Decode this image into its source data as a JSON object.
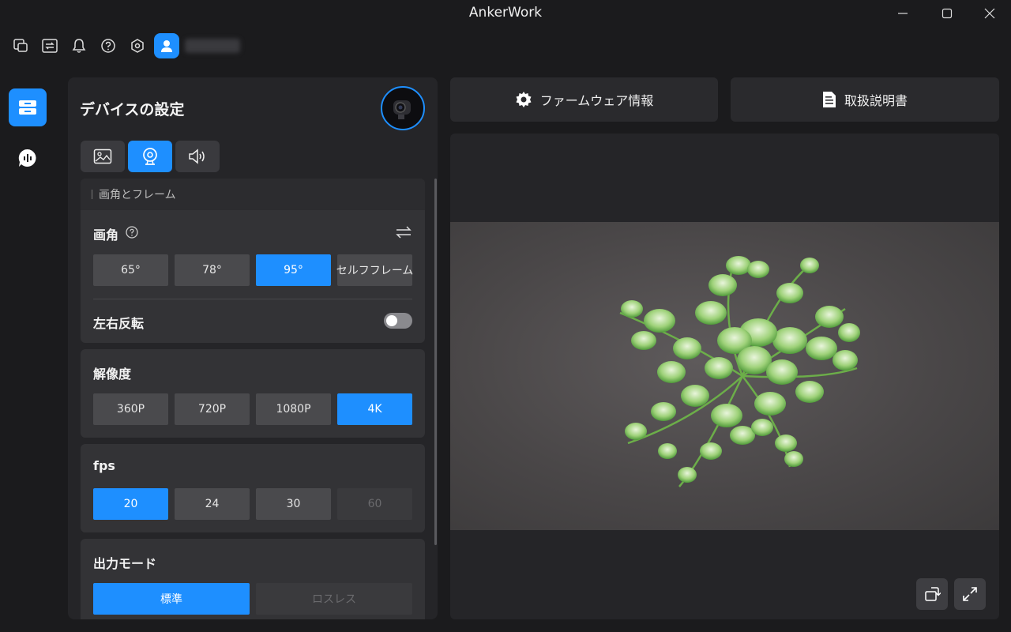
{
  "app": {
    "title": "AnkerWork"
  },
  "toolbar": {
    "icons": [
      "window-switch-icon",
      "swap-icon",
      "bell-icon",
      "help-icon",
      "hexagon-settings-icon"
    ]
  },
  "settings": {
    "title": "デバイスの設定",
    "tabs": [
      {
        "icon": "image-icon",
        "active": false
      },
      {
        "icon": "webcam-icon",
        "active": true
      },
      {
        "icon": "speaker-icon",
        "active": false
      }
    ],
    "fov_section": {
      "header": "画角とフレーム",
      "fov_label": "画角",
      "options": [
        {
          "label": "65°",
          "state": "normal"
        },
        {
          "label": "78°",
          "state": "normal"
        },
        {
          "label": "95°",
          "state": "active"
        },
        {
          "label": "セルフフレーム",
          "state": "normal"
        }
      ],
      "mirror_label": "左右反転",
      "mirror_on": false
    },
    "resolution": {
      "label": "解像度",
      "options": [
        {
          "label": "360P",
          "state": "normal"
        },
        {
          "label": "720P",
          "state": "normal"
        },
        {
          "label": "1080P",
          "state": "normal"
        },
        {
          "label": "4K",
          "state": "active"
        }
      ]
    },
    "fps": {
      "label": "fps",
      "options": [
        {
          "label": "20",
          "state": "active"
        },
        {
          "label": "24",
          "state": "normal"
        },
        {
          "label": "30",
          "state": "normal"
        },
        {
          "label": "60",
          "state": "disabled"
        }
      ]
    },
    "output_mode": {
      "label": "出力モード",
      "options": [
        {
          "label": "標準",
          "state": "active"
        },
        {
          "label": "ロスレス",
          "state": "disabled"
        }
      ]
    }
  },
  "right": {
    "firmware_label": "ファームウェア情報",
    "manual_label": "取扱説明書"
  },
  "colors": {
    "accent": "#1e8fff",
    "background": "#1b1b1d",
    "panel": "#252528",
    "card": "#333336"
  }
}
